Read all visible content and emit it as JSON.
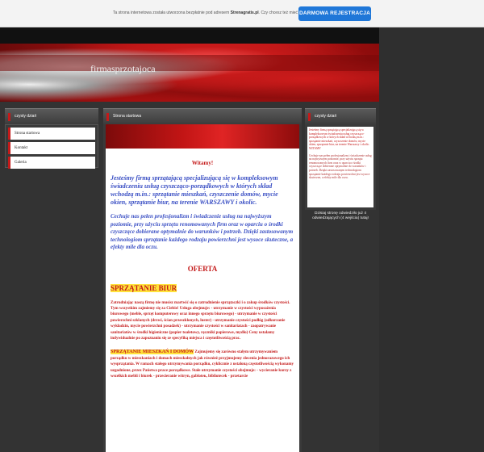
{
  "notice": {
    "text_prefix": "Ta strona internetowa została utworzona bezpłatnie pod adresem",
    "site_link": "Strenagratis.pl",
    "text_suffix": ". Czy chcesz też mieć własną stronę?",
    "button_label": "DARMOWA REJESTRACJA"
  },
  "header": {
    "title": "firmasprzotajoca"
  },
  "sidebar": {
    "heading": "czysty dziań",
    "items": [
      {
        "label": "Strona startowa"
      },
      {
        "label": "Kontakt"
      },
      {
        "label": "Galeria"
      }
    ]
  },
  "center": {
    "heading": "Strona startowa",
    "welcome": "Witamy!",
    "lead": "Jesteśmy firmą sprzątającą specjalizującą się w kompleksowym świadczeniu usług czyszcząco-porządkowych w których skład wchodzą m.in.: sprzątanie mieszkań, czyszczenie domów, mycie okien, sprzątanie biur, na terenie WARSZAWY i okolic.",
    "lead2": "Cechuje nas pełen profesjonalizm i świadczenie usług na najwyższym poziomie, przy użyciu sprzętu renomowanych firm oraz w oparciu o środki czyszczące dobierane optymalnie do warunków i potrzeb. Dzięki zastosowanym technologiom sprzątanie każdego rodzaju powierzchni jest wysoce skuteczne, a efekty mile dla oczu.",
    "offer": "OFERTA",
    "section1_title": "SPRZĄTANIE BIUR",
    "section1_text": "Zatrudniając naszą firmę nie musisz martwić się o zatrudnienie sprzątaczki i o zakup środków czystości. Tym wszystkim zajmiemy się za Ciebie! Usługa obejmuje: - utrzymanie w czystości wyposażenia biurowego (meble, sprzęt komputerowy oraz innego sprzętu biurowego) - utrzymanie w czystości powierzchni szklanych (drzwi, ścian przeszklonych, luster) - utrzymanie czystości podłóg (odkurzanie wykładzin, mycie powierzchni posadzek) - utrzymanie czystości w sanitariatach - zaopatrywanie sanitariatów w środki higieniczne (papier toaletowy, ręczniki papierowe, mydło) Ceny ustalamy indywidualnie po zapoznaniu się ze specyfiką miejsca i częstotliwością prac.",
    "section2_title": "SPRZĄTANIE MIESZKAŃ I DOMÓW",
    "section2_text": " Zajmujemy się zarówno stałym utrzymywaniem porządku w mieszkaniach i domach mieszkalnych jak również przyjmujemy zlecenia jednorazowego ich wysprzątania. W ramach stałego utrzymywania porządku, cyklicznie z ustaloną częstotliwością wykonamy uzgodnione, przez Państwa prace porządkowe. Stałe utrzymanie czystości obejmuje: - wycieranie kurzy z wszelkich mebli i biurek - przecieranie witryn, gabloteк, bibliotecek - przetarcie"
  },
  "right": {
    "heading": "czysty dziań",
    "text1": "Jesteśmy firmą sprzątającą specjalizującą się w kompleksowym świadczeniu usług czyszcząco-porządkowych w których skład wchodzą m.in.: sprzątanie mieszkań, czyszczenie domów, mycie okien, sprzątanie biur, na terenie Warszawy i okolic.",
    "text_witamy": "WITAMY",
    "text2": "Cechuje nas pełen profesjonalizm i świadczenie usług na najwyższym poziomie, przy użyciu sprzętu renomowanych firm oraz w oparciu o środki czyszczące dobierane optymalnie do warunków i potrzeb. Dzięki zastosowanym technologiom sprzątanie każdego rodzaju powierzchni jest wysoce skuteczne, a efekty mile dla oczu.",
    "counter": "Dzisiaj stronę odwiedziło już 4 odwiedzających (4 wejścia) tutaj!"
  },
  "colors": {
    "accent": "#c41a1a",
    "button": "#1f77d8",
    "lead_text": "#3a4fc4",
    "highlight": "#ffe23a"
  }
}
